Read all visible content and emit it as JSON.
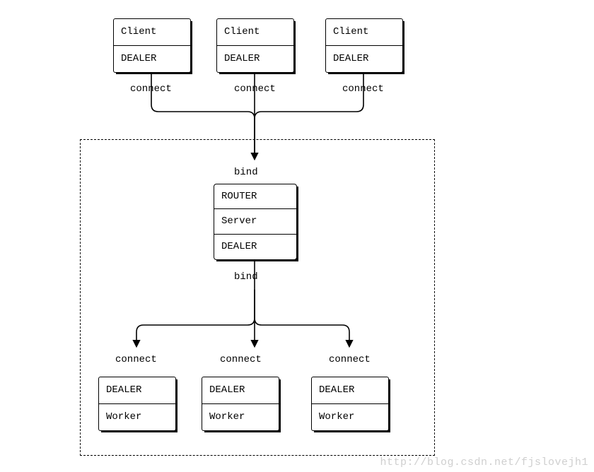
{
  "clients": [
    {
      "top": "Client",
      "bottom": "DEALER",
      "connect": "connect"
    },
    {
      "top": "Client",
      "bottom": "DEALER",
      "connect": "connect"
    },
    {
      "top": "Client",
      "bottom": "DEALER",
      "connect": "connect"
    }
  ],
  "server": {
    "bind_top": "bind",
    "row1": "ROUTER",
    "row2": "Server",
    "row3": "DEALER",
    "bind_bottom": "bind"
  },
  "workers": [
    {
      "top": "DEALER",
      "bottom": "Worker",
      "connect": "connect"
    },
    {
      "top": "DEALER",
      "bottom": "Worker",
      "connect": "connect"
    },
    {
      "top": "DEALER",
      "bottom": "Worker",
      "connect": "connect"
    }
  ],
  "watermark": "http://blog.csdn.net/fjslovejh1"
}
